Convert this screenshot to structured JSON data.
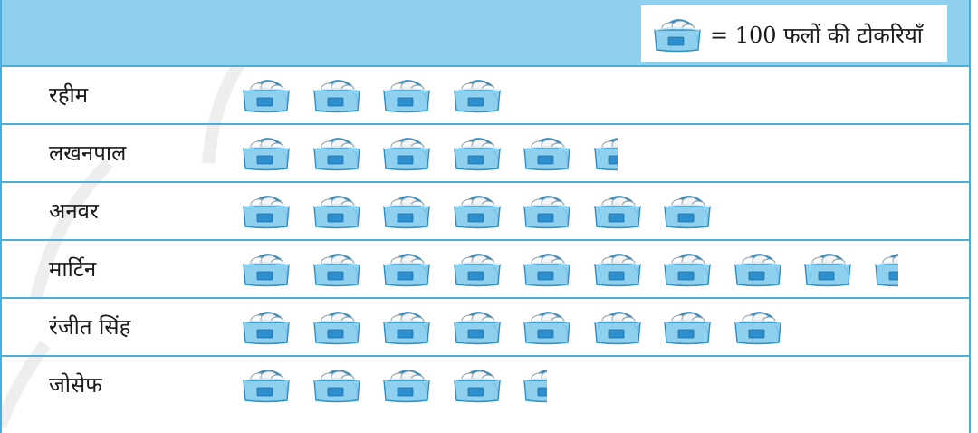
{
  "chart_data": {
    "type": "pictograph",
    "key": {
      "icon": "fruit-basket-icon",
      "text": "= 100 फलों की टोकरियाँ",
      "value_per_icon": 100
    },
    "categories": [
      "रहीम",
      "लखनपाल",
      "अनवर",
      "मार्टिन",
      "रंजीत सिंह",
      "जोसेफ"
    ],
    "values": [
      400,
      550,
      700,
      950,
      800,
      450
    ],
    "icons_per_row": [
      4,
      5.5,
      7,
      9.5,
      8,
      4.5
    ]
  },
  "colors": {
    "header": "#8fd0ee",
    "grid": "#4aaed8",
    "basket_body": "#8fd0ee",
    "basket_outline": "#2f8fc4",
    "basket_label": "#2d8fd0"
  }
}
